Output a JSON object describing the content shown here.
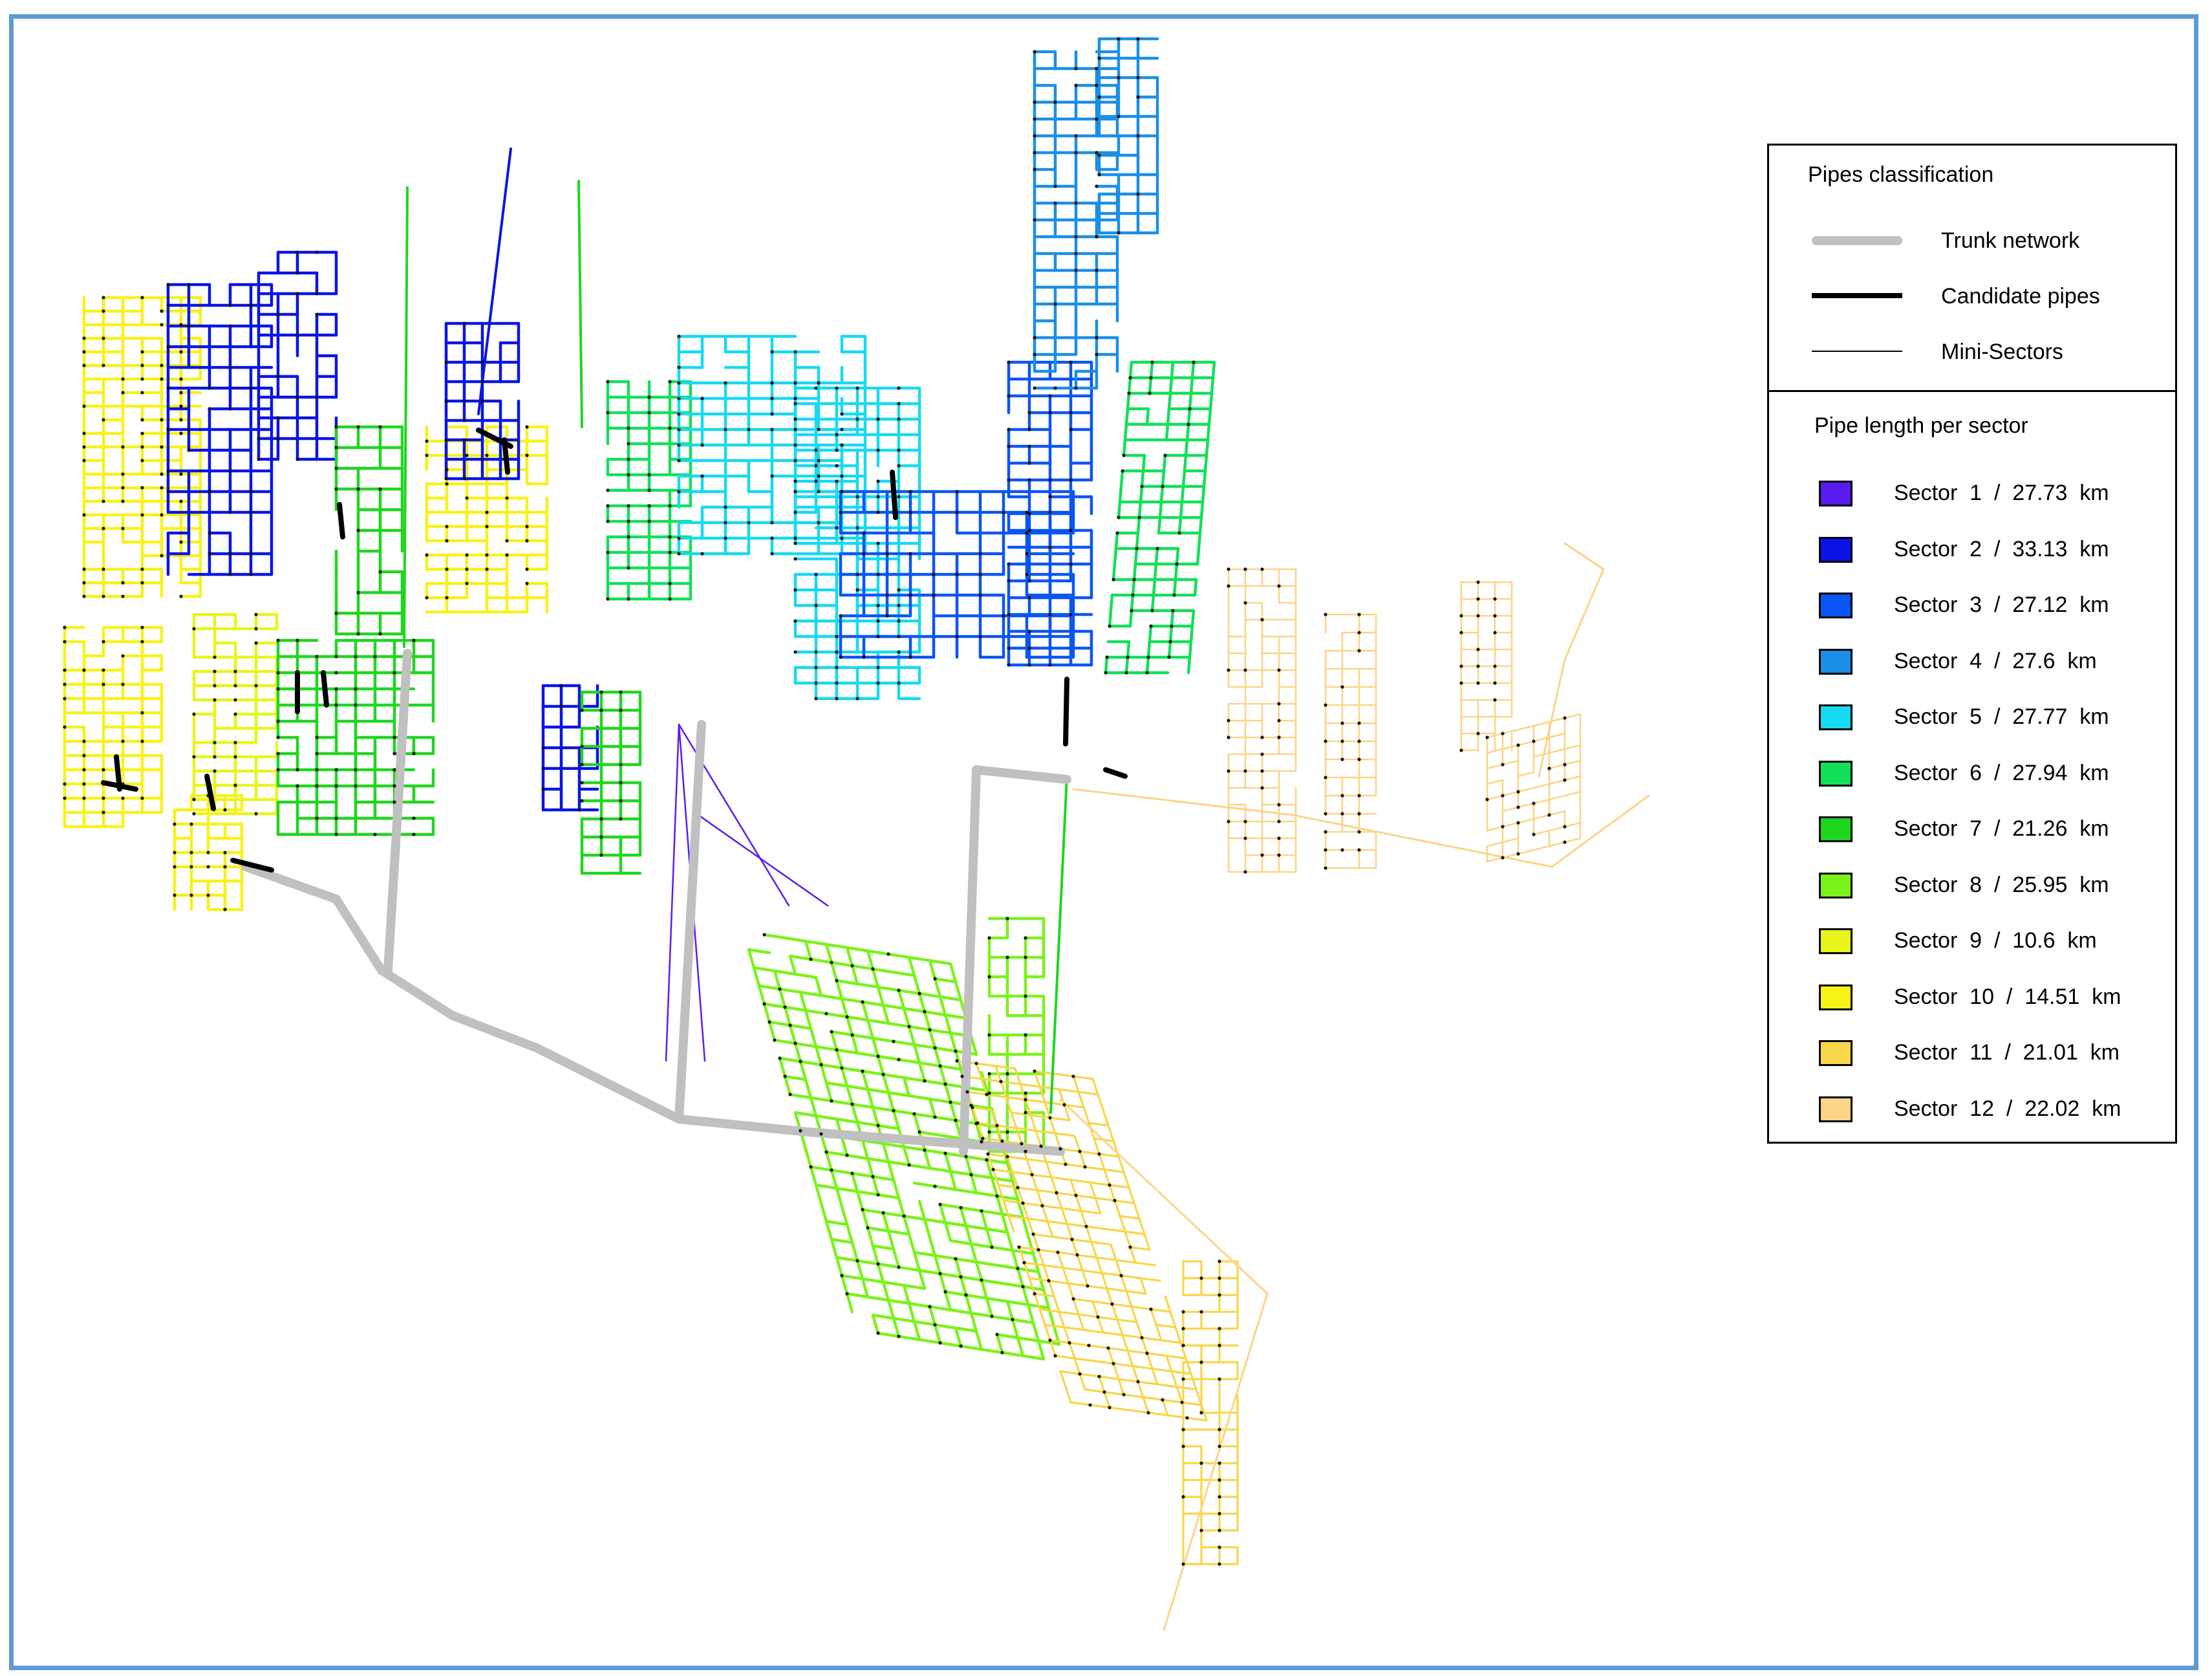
{
  "legend": {
    "classification_title": "Pipes classification",
    "classes": [
      {
        "label": "Trunk network",
        "color": "#c0c0c0",
        "weight": "heavy"
      },
      {
        "label": "Candidate pipes",
        "color": "#000000",
        "weight": "medium"
      },
      {
        "label": "Mini-Sectors",
        "color": "#000000",
        "weight": "thin"
      }
    ],
    "length_title": "Pipe length per sector",
    "sectors": [
      {
        "label": "Sector  1  /  27.73  km",
        "color": "#5a1bf0"
      },
      {
        "label": "Sector  2  /  33.13  km",
        "color": "#0a14e6"
      },
      {
        "label": "Sector  3  /  27.12  km",
        "color": "#0a55f5"
      },
      {
        "label": "Sector  4  /  27.6  km",
        "color": "#1a8fe8"
      },
      {
        "label": "Sector  5  /  27.77  km",
        "color": "#17d9f2"
      },
      {
        "label": "Sector  6  /  27.94  km",
        "color": "#12e05a"
      },
      {
        "label": "Sector  7  /  21.26  km",
        "color": "#1fd61f"
      },
      {
        "label": "Sector  8  /  25.95  km",
        "color": "#7cf21c"
      },
      {
        "label": "Sector  9  /  10.6  km",
        "color": "#e8f51a"
      },
      {
        "label": "Sector  10  /  14.51  km",
        "color": "#f7f217"
      },
      {
        "label": "Sector  11  /  21.01  km",
        "color": "#f7d64a"
      },
      {
        "label": "Sector  12  /  22.02  km",
        "color": "#fcd487"
      }
    ]
  }
}
